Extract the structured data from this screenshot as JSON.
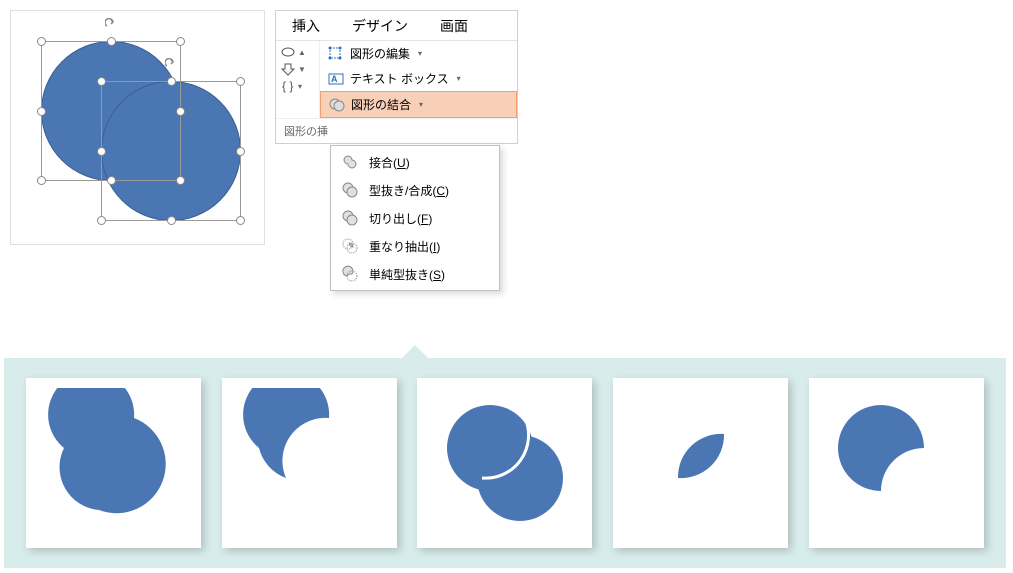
{
  "ribbon": {
    "tabs": [
      "挿入",
      "デザイン",
      "画面"
    ],
    "buttons": {
      "edit_shape": "図形の編集",
      "text_box": "テキスト ボックス",
      "merge_shapes": "図形の結合"
    },
    "group_label": "図形の挿"
  },
  "merge_menu": {
    "items": [
      {
        "label": "接合",
        "key": "U"
      },
      {
        "label": "型抜き/合成",
        "key": "C"
      },
      {
        "label": "切り出し",
        "key": "F"
      },
      {
        "label": "重なり抽出",
        "key": "I"
      },
      {
        "label": "単純型抜き",
        "key": "S"
      }
    ]
  },
  "shape_color": "#4a77b4"
}
